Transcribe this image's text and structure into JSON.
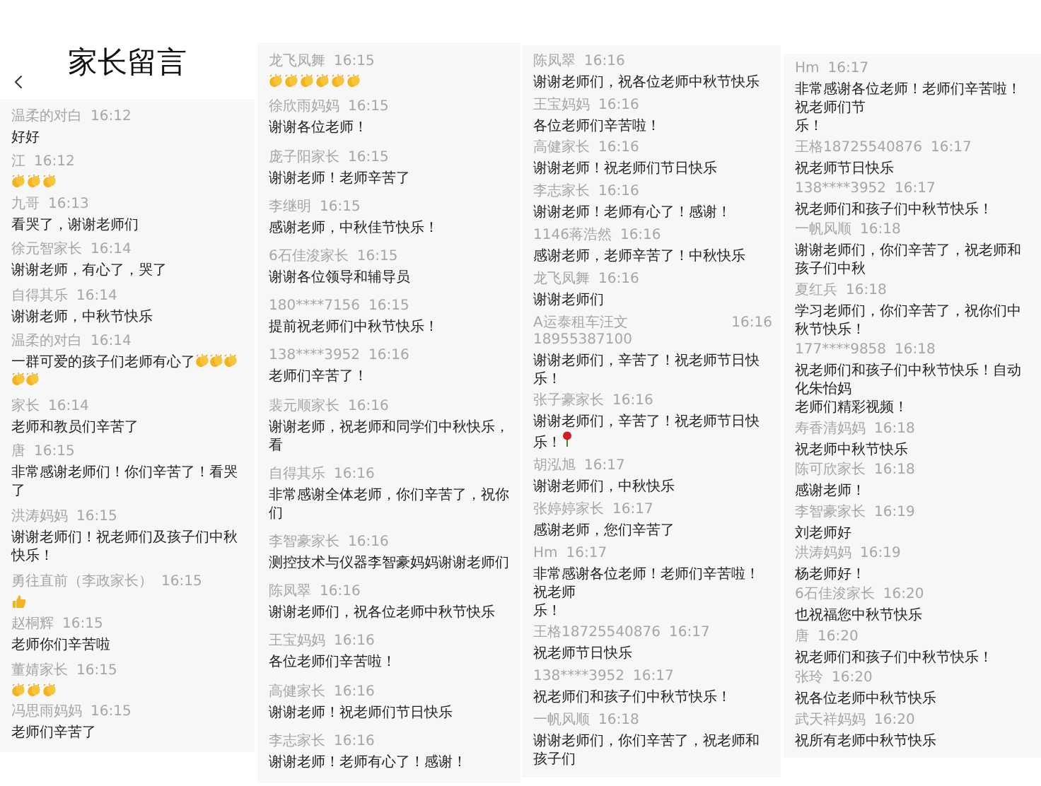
{
  "panels": [
    {
      "header": {
        "title": "家长留言"
      },
      "messages": [
        {
          "sender": "温柔的对白",
          "time": "16:12",
          "text": "好好"
        },
        {
          "sender": "江",
          "time": "16:12",
          "reactions": [
            {
              "kind": "clap"
            },
            {
              "kind": "clap"
            },
            {
              "kind": "clap"
            }
          ]
        },
        {
          "sender": "九哥",
          "time": "16:13",
          "text": "看哭了，谢谢老师们"
        },
        {
          "sender": "徐元智家长",
          "time": "16:14",
          "text": "谢谢老师，有心了，哭了"
        },
        {
          "sender": "自得其乐",
          "time": "16:14",
          "text": "谢谢老师，中秋节快乐"
        },
        {
          "sender": "温柔的对白",
          "time": "16:14",
          "text": "一群可爱的孩子们老师有心了",
          "reactions": [
            {
              "kind": "clap"
            },
            {
              "kind": "clap"
            },
            {
              "kind": "clap"
            },
            {
              "kind": "clap"
            },
            {
              "kind": "clap"
            }
          ]
        },
        {
          "sender": "家长",
          "time": "16:14",
          "text": "老师和教员们辛苦了"
        },
        {
          "sender": "唐",
          "time": "16:15",
          "text": "非常感谢老师们！你们辛苦了！看哭了"
        },
        {
          "sender": "洪涛妈妈",
          "time": "16:15",
          "text": "谢谢老师们！祝老师们及孩子们中秋快乐！"
        },
        {
          "sender": "勇往直前（李政家长）",
          "time": "16:15",
          "reactions": [
            {
              "kind": "thumbs_up"
            }
          ]
        },
        {
          "sender": "赵桐辉",
          "time": "16:15",
          "text": "老师你们辛苦啦"
        },
        {
          "sender": "董婧家长",
          "time": "16:15",
          "reactions": [
            {
              "kind": "clap"
            },
            {
              "kind": "clap"
            },
            {
              "kind": "clap"
            }
          ]
        },
        {
          "sender": "冯思雨妈妈",
          "time": "16:15",
          "text": "老师们辛苦了"
        }
      ]
    },
    {
      "messages": [
        {
          "sender": "龙飞凤舞",
          "time": "16:15",
          "reactions": [
            {
              "kind": "clap"
            },
            {
              "kind": "clap"
            },
            {
              "kind": "clap"
            },
            {
              "kind": "clap"
            },
            {
              "kind": "clap"
            },
            {
              "kind": "clap"
            }
          ]
        },
        {
          "sender": "徐欣雨妈妈",
          "time": "16:15",
          "text": "谢谢各位老师！"
        },
        {
          "sender": "庞子阳家长",
          "time": "16:15",
          "text": "谢谢老师！老师辛苦了"
        },
        {
          "sender": "李继明",
          "time": "16:15",
          "text": "感谢老师，中秋佳节快乐！"
        },
        {
          "sender": "6石佳浚家长",
          "time": "16:15",
          "text": "谢谢各位领导和辅导员"
        },
        {
          "sender": "180****7156",
          "time": "16:15",
          "text": "提前祝老师们中秋节快乐！"
        },
        {
          "sender": "138****3952",
          "time": "16:16",
          "text": "老师们辛苦了！"
        },
        {
          "sender": "裴元顺家长",
          "time": "16:16",
          "text": "谢谢老师，祝老师和同学们中秋快乐，看"
        },
        {
          "sender": "自得其乐",
          "time": "16:16",
          "text": "非常感谢全体老师，你们辛苦了，祝你们"
        },
        {
          "sender": "李智豪家长",
          "time": "16:16",
          "text": "测控技术与仪器李智豪妈妈谢谢老师们"
        },
        {
          "sender": "陈凤翠",
          "time": "16:16",
          "text": "谢谢老师们，祝各位老师中秋节快乐"
        },
        {
          "sender": "王宝妈妈",
          "time": "16:16",
          "text": "各位老师们辛苦啦！"
        },
        {
          "sender": "高健家长",
          "time": "16:16",
          "text": "谢谢老师！祝老师们节日快乐"
        },
        {
          "sender": "李志家长",
          "time": "16:16",
          "text": "谢谢老师！老师有心了！感谢！"
        }
      ]
    },
    {
      "messages": [
        {
          "sender": "陈凤翠",
          "time": "16:16",
          "text": "谢谢老师们，祝各位老师中秋节快乐"
        },
        {
          "sender": "王宝妈妈",
          "time": "16:16",
          "text": "各位老师们辛苦啦！"
        },
        {
          "sender": "高健家长",
          "time": "16:16",
          "text": "谢谢老师！祝老师们节日快乐"
        },
        {
          "sender": "李志家长",
          "time": "16:16",
          "text": "谢谢老师！老师有心了！感谢！"
        },
        {
          "sender": "1146蒋浩然",
          "time": "16:16",
          "text": "感谢老师，老师辛苦了！中秋快乐"
        },
        {
          "sender": "龙飞凤舞",
          "time": "16:16",
          "text": "谢谢老师们"
        },
        {
          "sender": "A运泰租车汪文18955387100",
          "time": "16:16",
          "text": "谢谢老师们，辛苦了！祝老师节日快乐！"
        },
        {
          "sender": "张子豪家长",
          "time": "16:16",
          "text": "谢谢老师们，辛苦了！祝老师节日快乐！",
          "reactions": [
            {
              "kind": "rose"
            }
          ]
        },
        {
          "sender": "胡泓旭",
          "time": "16:17",
          "text": "谢谢老师们，中秋快乐"
        },
        {
          "sender": "张婷婷家长",
          "time": "16:17",
          "text": "感谢老师，您们辛苦了"
        },
        {
          "sender": "Hm",
          "time": "16:17",
          "lines": [
            "非常感谢各位老师！老师们辛苦啦！祝老师",
            "乐！"
          ]
        },
        {
          "sender": "王格18725540876",
          "time": "16:17",
          "text": "祝老师节日快乐"
        },
        {
          "sender": "138****3952",
          "time": "16:17",
          "text": "祝老师们和孩子们中秋节快乐！"
        },
        {
          "sender": "一帆风顺",
          "time": "16:18",
          "text": "谢谢老师们，你们辛苦了，祝老师和孩子们"
        }
      ]
    },
    {
      "messages": [
        {
          "sender": "Hm",
          "time": "16:17",
          "lines": [
            "非常感谢各位老师！老师们辛苦啦！祝老师们节",
            "乐！"
          ]
        },
        {
          "sender": "王格18725540876",
          "time": "16:17",
          "text": "祝老师节日快乐"
        },
        {
          "sender": "138****3952",
          "time": "16:17",
          "text": "祝老师们和孩子们中秋节快乐！"
        },
        {
          "sender": "一帆风顺",
          "time": "16:18",
          "text": "谢谢老师们，你们辛苦了，祝老师和孩子们中秋"
        },
        {
          "sender": "夏红兵",
          "time": "16:18",
          "text": "学习老师们，你们辛苦了，祝你们中秋节快乐！"
        },
        {
          "sender": "177****9858",
          "time": "16:18",
          "lines": [
            "祝老师们和孩子们中秋节快乐！自动化朱怡妈",
            "老师们精彩视频！"
          ]
        },
        {
          "sender": "寿香清妈妈",
          "time": "16:18",
          "text": "祝老师中秋节快乐"
        },
        {
          "sender": "陈可欣家长",
          "time": "16:18",
          "text": "感谢老师！"
        },
        {
          "sender": "李智豪家长",
          "time": "16:19",
          "text": "刘老师好"
        },
        {
          "sender": "洪涛妈妈",
          "time": "16:19",
          "text": "杨老师好！"
        },
        {
          "sender": "6石佳浚家长",
          "time": "16:20",
          "text": "也祝福您中秋节快乐"
        },
        {
          "sender": "唐",
          "time": "16:20",
          "text": "祝老师们和孩子们中秋节快乐！"
        },
        {
          "sender": "张玲",
          "time": "16:20",
          "text": "祝各位老师中秋节快乐"
        },
        {
          "sender": "武天祥妈妈",
          "time": "16:20",
          "text": "祝所有老师中秋节快乐"
        }
      ]
    }
  ]
}
